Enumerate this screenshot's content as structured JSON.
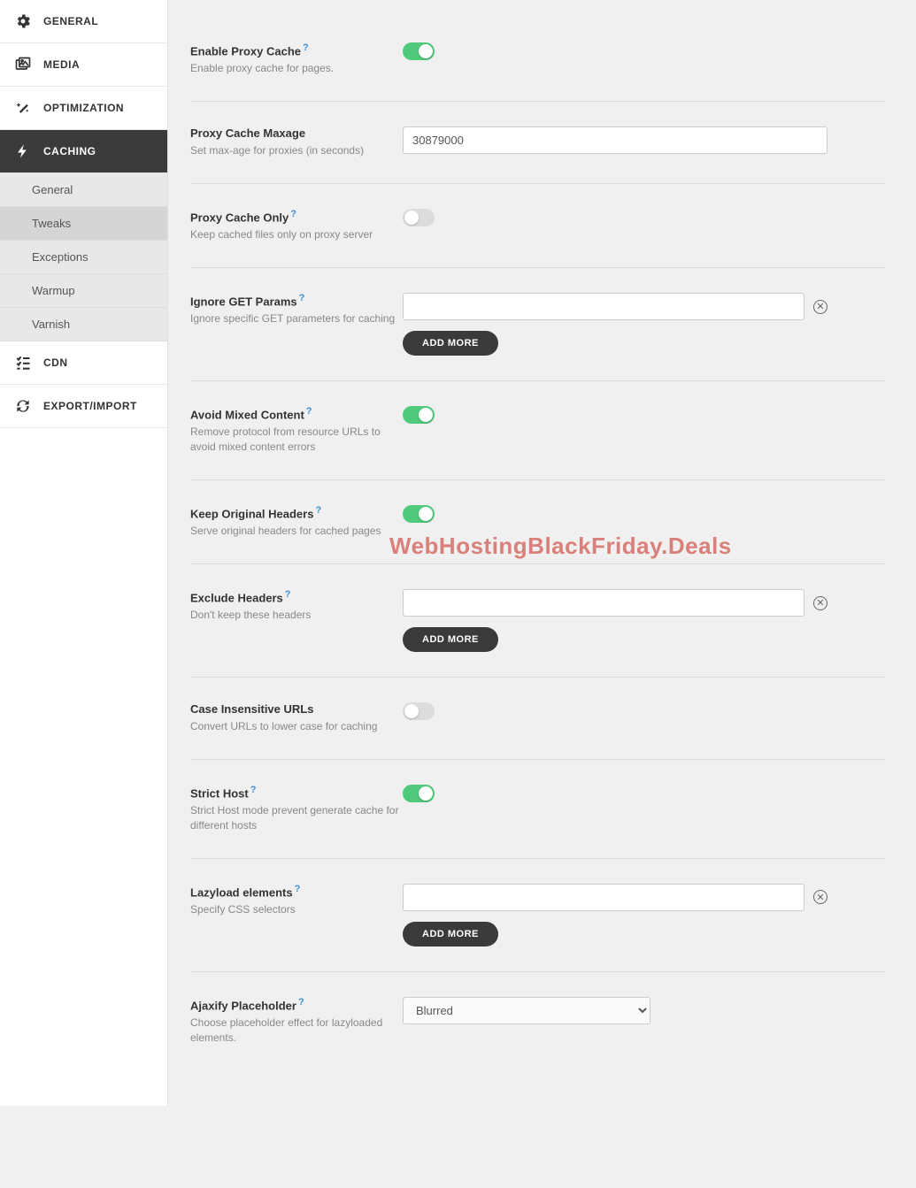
{
  "sidebar": {
    "nav": [
      {
        "id": "general",
        "label": "GENERAL",
        "active": false
      },
      {
        "id": "media",
        "label": "MEDIA",
        "active": false
      },
      {
        "id": "optimization",
        "label": "OPTIMIZATION",
        "active": false
      },
      {
        "id": "caching",
        "label": "CACHING",
        "active": true
      },
      {
        "id": "cdn",
        "label": "CDN",
        "active": false
      },
      {
        "id": "export-import",
        "label": "EXPORT/IMPORT",
        "active": false
      }
    ],
    "sub": [
      {
        "id": "general",
        "label": "General",
        "active": false
      },
      {
        "id": "tweaks",
        "label": "Tweaks",
        "active": true
      },
      {
        "id": "exceptions",
        "label": "Exceptions",
        "active": false
      },
      {
        "id": "warmup",
        "label": "Warmup",
        "active": false
      },
      {
        "id": "varnish",
        "label": "Varnish",
        "active": false
      }
    ]
  },
  "settings": {
    "enable_proxy_cache": {
      "title": "Enable Proxy Cache",
      "desc": "Enable proxy cache for pages.",
      "help": true,
      "value": true
    },
    "proxy_cache_maxage": {
      "title": "Proxy Cache Maxage",
      "desc": "Set max-age for proxies (in seconds)",
      "help": false,
      "value": "30879000"
    },
    "proxy_cache_only": {
      "title": "Proxy Cache Only",
      "desc": "Keep cached files only on proxy server",
      "help": true,
      "value": false
    },
    "ignore_get_params": {
      "title": "Ignore GET Params",
      "desc": "Ignore specific GET parameters for caching",
      "help": true,
      "value": ""
    },
    "avoid_mixed_content": {
      "title": "Avoid Mixed Content",
      "desc": "Remove protocol from resource URLs to avoid mixed content errors",
      "help": true,
      "value": true
    },
    "keep_original_headers": {
      "title": "Keep Original Headers",
      "desc": "Serve original headers for cached pages",
      "help": true,
      "value": true
    },
    "exclude_headers": {
      "title": "Exclude Headers",
      "desc": "Don't keep these headers",
      "help": true,
      "value": ""
    },
    "case_insensitive_urls": {
      "title": "Case Insensitive URLs",
      "desc": "Convert URLs to lower case for caching",
      "help": false,
      "value": false
    },
    "strict_host": {
      "title": "Strict Host",
      "desc": "Strict Host mode prevent generate cache for different hosts",
      "help": true,
      "value": true
    },
    "lazyload_elements": {
      "title": "Lazyload elements",
      "desc": "Specify CSS selectors",
      "help": true,
      "value": ""
    },
    "ajaxify_placeholder": {
      "title": "Ajaxify Placeholder",
      "desc": "Choose placeholder effect for lazyloaded elements.",
      "help": true,
      "value": "Blurred"
    }
  },
  "ui": {
    "add_more": "ADD MORE",
    "help_symbol": "?"
  },
  "watermark": "WebHostingBlackFriday.Deals"
}
